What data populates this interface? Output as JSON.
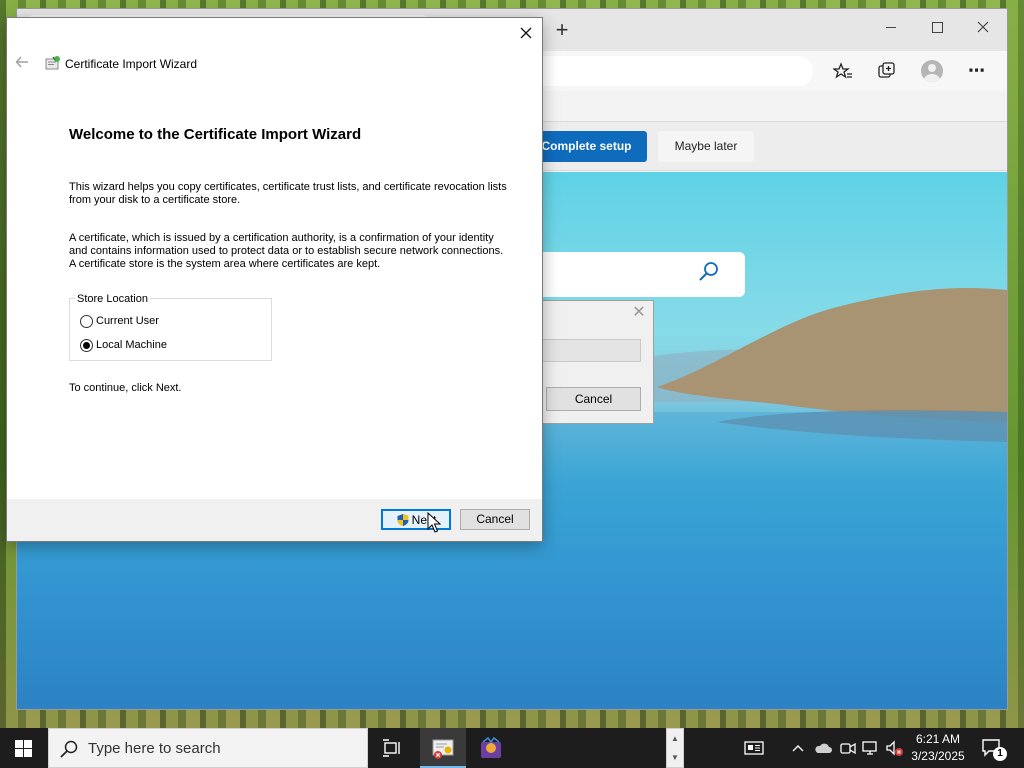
{
  "browser": {
    "new_tab_glyph": "+",
    "setup_bar": {
      "complete_label": "Complete setup",
      "maybe_label": "Maybe later"
    },
    "icons": [
      "favorites-icon",
      "collections-icon",
      "profile-icon",
      "more-icon",
      "search-icon"
    ]
  },
  "background_dialog": {
    "cancel_label": "Cancel"
  },
  "wizard": {
    "window_title": "Certificate Import Wizard",
    "heading": "Welcome to the Certificate Import Wizard",
    "paragraph1": "This wizard helps you copy certificates, certificate trust lists, and certificate revocation lists from your disk to a certificate store.",
    "paragraph2": "A certificate, which is issued by a certification authority, is a confirmation of your identity and contains information used to protect data or to establish secure network connections. A certificate store is the system area where certificates are kept.",
    "store_location": {
      "legend": "Store Location",
      "options": [
        {
          "label": "Current User",
          "selected": false
        },
        {
          "label": "Local Machine",
          "selected": true
        }
      ]
    },
    "continue_text": "To continue, click Next.",
    "next_label": "Next",
    "cancel_label": "Cancel"
  },
  "taskbar": {
    "search_placeholder": "Type here to search",
    "clock_time": "6:21 AM",
    "clock_date": "3/23/2025",
    "notification_count": "1"
  },
  "colors": {
    "accent": "#0078d7",
    "edge_primary": "#0f6cbd",
    "taskbar": "#1d1d1d"
  }
}
